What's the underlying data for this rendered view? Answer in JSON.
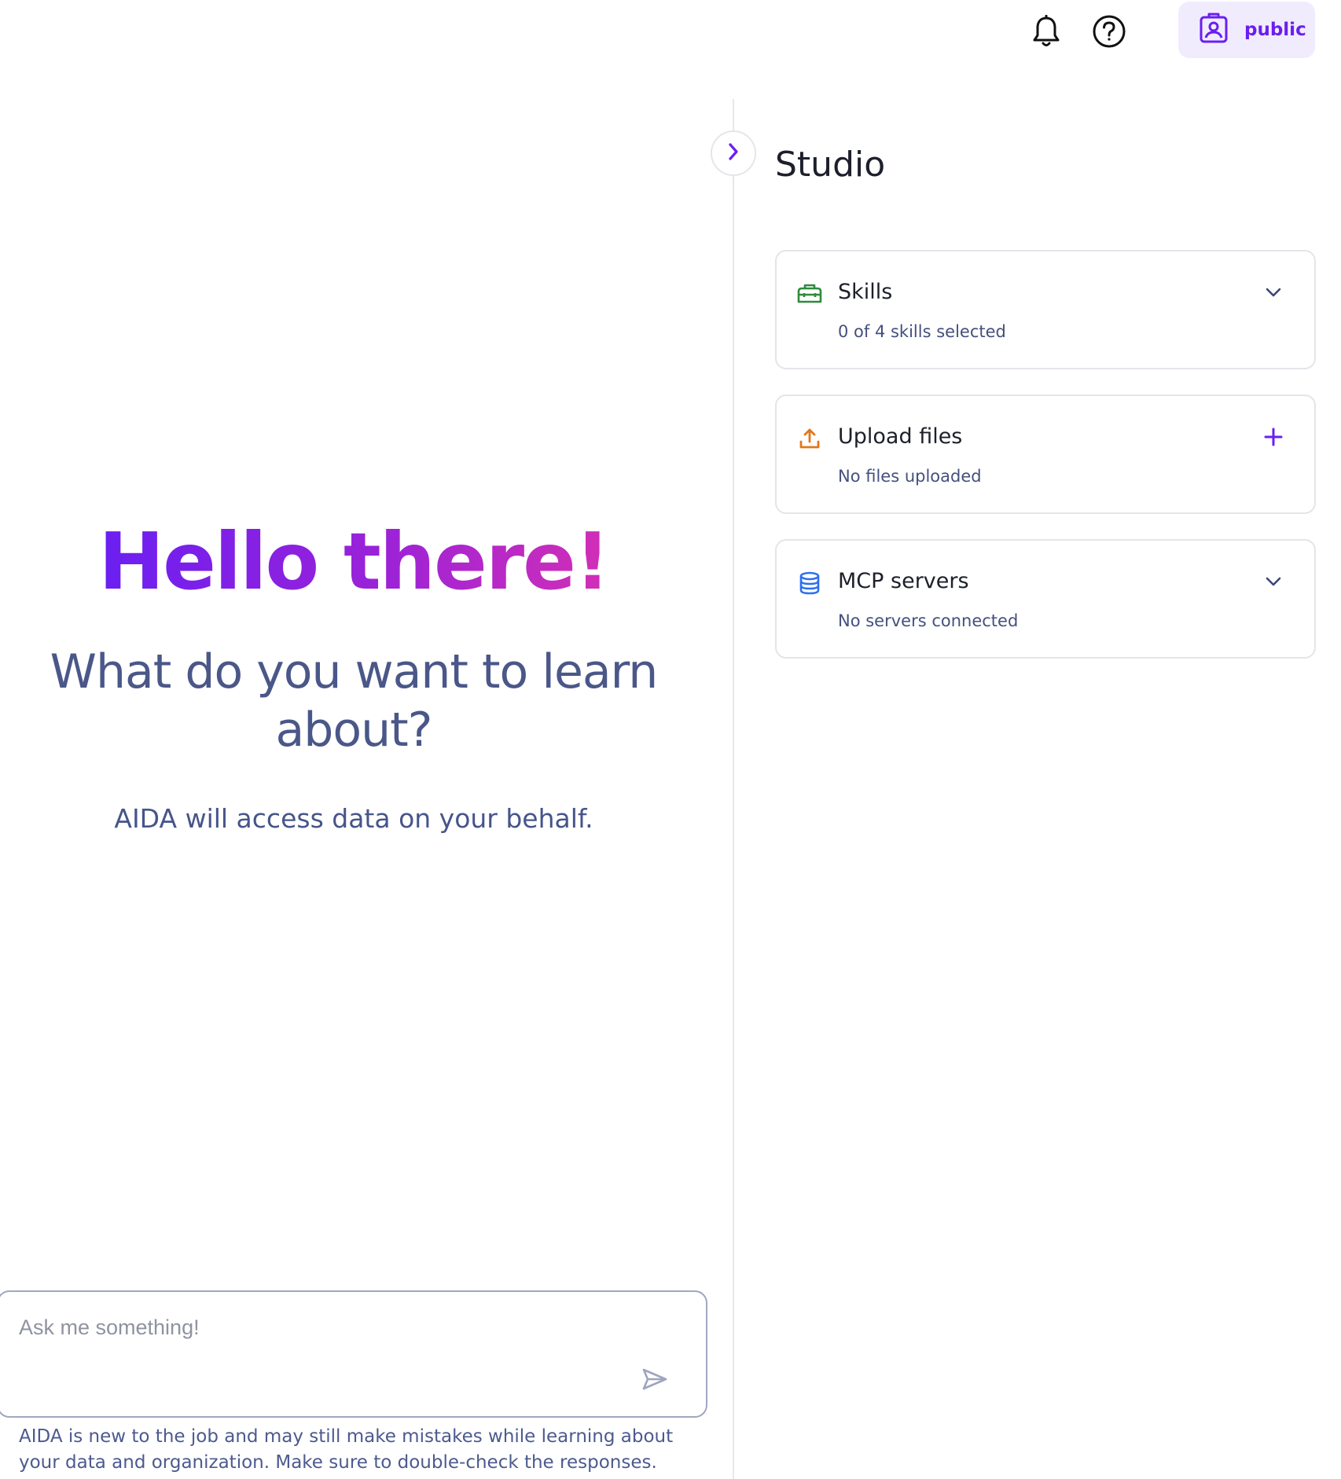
{
  "header": {
    "notifications_icon": "bell-icon",
    "help_icon": "question-circle-icon",
    "user": {
      "icon": "id-badge-icon",
      "label": "public"
    }
  },
  "hero": {
    "greeting": "Hello there!",
    "question": "What do you want to learn about?",
    "subtitle": "AIDA will access data on your behalf."
  },
  "chat": {
    "placeholder": "Ask me something!",
    "value": "",
    "send_icon": "send-icon",
    "disclaimer": "AIDA is new to the job and may still make mistakes while learning about your data and organization. Make sure to double-check the responses."
  },
  "studio": {
    "title": "Studio",
    "cards": [
      {
        "title": "Skills",
        "subtitle": "0 of 4 skills selected",
        "icon": "toolbox-icon",
        "action": "chevron-down-icon",
        "color": "#2e8b3d"
      },
      {
        "title": "Upload files",
        "subtitle": "No files uploaded",
        "icon": "upload-icon",
        "action": "plus-icon",
        "color": "#e2761b"
      },
      {
        "title": "MCP servers",
        "subtitle": "No servers connected",
        "icon": "database-icon",
        "action": "chevron-down-icon",
        "color": "#2d6ff0"
      }
    ]
  },
  "colors": {
    "accent": "#6a1ff0",
    "gradient_start": "#6a1ff2",
    "gradient_end": "#d22fb6",
    "text_muted": "#4a5788"
  }
}
